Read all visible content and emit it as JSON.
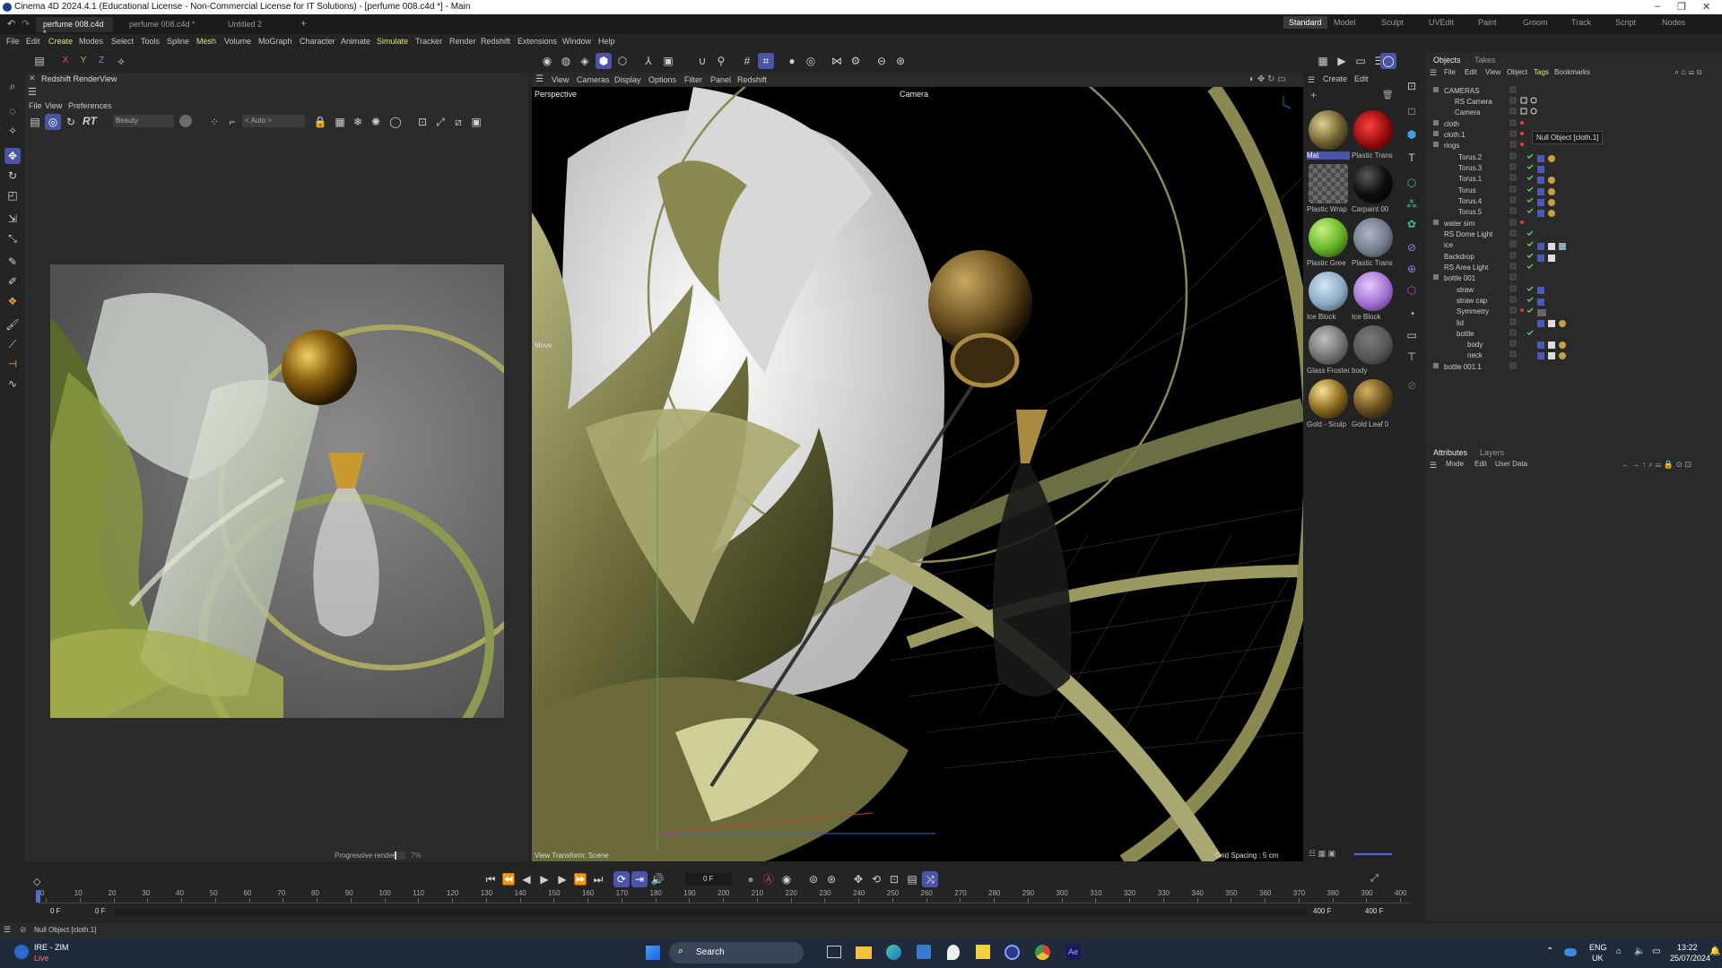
{
  "window": {
    "title": "Cinema 4D 2024.4.1 (Educational License - Non-Commercial License for IT Solutions) - [perfume 008.c4d *] - Main",
    "min": "–",
    "max": "❐",
    "close": "✕"
  },
  "doc_tabs": [
    "perfume 008.c4d *",
    "perfume 008.c4d *",
    "Untitled 2",
    "+"
  ],
  "layouts": [
    "Standard",
    "Model",
    "Sculpt",
    "UVEdit",
    "Paint",
    "Groom",
    "Track",
    "Script",
    "Nodes"
  ],
  "menu": [
    "File",
    "Edit",
    "Create",
    "Modes",
    "Select",
    "Tools",
    "Spline",
    "Mesh",
    "Volume",
    "MoGraph",
    "Character",
    "Animate",
    "Simulate",
    "Tracker",
    "Render",
    "Redshift",
    "Extensions",
    "Window",
    "Help"
  ],
  "axis_buttons": [
    "X",
    "Y",
    "Z"
  ],
  "renderview": {
    "title": "Redshift RenderView",
    "menu": [
      "File",
      "View",
      "Preferences"
    ],
    "aov": "Beauty",
    "rt": "RT",
    "auto": "< Auto >",
    "progress_label": "Progressive rendering",
    "progress_pct": "7%",
    "progress_value": 0.07
  },
  "viewport": {
    "menu": [
      "View",
      "Cameras",
      "Display",
      "Options",
      "Filter",
      "Panel",
      "Redshift"
    ],
    "label": "Perspective",
    "camera": "Camera",
    "move": "Move",
    "view_transform": "View Transform: Scene",
    "grid_spacing": "Grid Spacing : 5 cm"
  },
  "materials": {
    "menu": [
      "Create",
      "Edit"
    ],
    "items": [
      {
        "name": "Mat",
        "color": "#6a5a2a",
        "selected": true
      },
      {
        "name": "Plastic Trans",
        "color": "#b01818"
      },
      {
        "name": "Plastic Wrap",
        "color": "#5a5a5a"
      },
      {
        "name": "Carpaint 00",
        "color": "#0e0e0e"
      },
      {
        "name": "Plastic Gree",
        "color": "#6ab82a"
      },
      {
        "name": "Plastic Trans",
        "color": "#707a88"
      },
      {
        "name": "Ice Block",
        "color": "#8aa8c0"
      },
      {
        "name": "Ice Block",
        "color": "#a070d0"
      },
      {
        "name": "Glass Frosted",
        "color": "#707070"
      },
      {
        "name": "body",
        "color": "#555555"
      },
      {
        "name": "Gold - Sculp",
        "color": "#8a6a20"
      },
      {
        "name": "Gold Leaf 0",
        "color": "#6a5020"
      }
    ]
  },
  "objects_panel": {
    "tabs": [
      "Objects",
      "Takes"
    ],
    "menu": [
      "File",
      "Edit",
      "View",
      "Object",
      "Tags",
      "Bookmarks"
    ],
    "tooltip": "Null Object [cloth.1]",
    "items": [
      {
        "name": "CAMERAS",
        "indent": 0
      },
      {
        "name": "RS Camera",
        "indent": 1
      },
      {
        "name": "Camera",
        "indent": 1
      },
      {
        "name": "cloth",
        "indent": 0
      },
      {
        "name": "cloth.1",
        "indent": 0
      },
      {
        "name": "rings",
        "indent": 0
      },
      {
        "name": "Torus.2",
        "indent": 1
      },
      {
        "name": "Torus.3",
        "indent": 1
      },
      {
        "name": "Torus.1",
        "indent": 1
      },
      {
        "name": "Torus",
        "indent": 1
      },
      {
        "name": "Torus.4",
        "indent": 1
      },
      {
        "name": "Torus.5",
        "indent": 1
      },
      {
        "name": "water sim",
        "indent": 0
      },
      {
        "name": "RS Dome Light",
        "indent": 0
      },
      {
        "name": "ice",
        "indent": 0
      },
      {
        "name": "Backdrop",
        "indent": 0
      },
      {
        "name": "RS Area Light",
        "indent": 0
      },
      {
        "name": "bottle 001",
        "indent": 0
      },
      {
        "name": "straw",
        "indent": 1
      },
      {
        "name": "straw cap",
        "indent": 1
      },
      {
        "name": "Symmetry",
        "indent": 1
      },
      {
        "name": "lid",
        "indent": 1
      },
      {
        "name": "bottle",
        "indent": 1
      },
      {
        "name": "body",
        "indent": 2
      },
      {
        "name": "neck",
        "indent": 2
      },
      {
        "name": "bottle 001.1",
        "indent": 0
      }
    ]
  },
  "attributes": {
    "tabs": [
      "Attributes",
      "Layers"
    ],
    "menu": [
      "Mode",
      "Edit",
      "User Data"
    ]
  },
  "timeline": {
    "frame": "0 F",
    "ticks": [
      "0",
      "10",
      "20",
      "30",
      "40",
      "50",
      "60",
      "70",
      "80",
      "90",
      "100",
      "110",
      "120",
      "130",
      "140",
      "150",
      "160",
      "170",
      "180",
      "190",
      "200",
      "210",
      "220",
      "230",
      "240",
      "250",
      "260",
      "270",
      "280",
      "290",
      "300",
      "310",
      "320",
      "330",
      "340",
      "350",
      "360",
      "370",
      "380",
      "390",
      "400"
    ],
    "start_a": "0 F",
    "start_b": "0 F",
    "end_a": "400 F",
    "end_b": "400 F"
  },
  "status": "Null Object [cloth.1]",
  "taskbar": {
    "weather_top": "IRE - ZIM",
    "weather_bottom": "Live",
    "search": "Search",
    "lang_top": "ENG",
    "lang_bottom": "UK",
    "time": "13:22",
    "date": "25/07/2024"
  }
}
